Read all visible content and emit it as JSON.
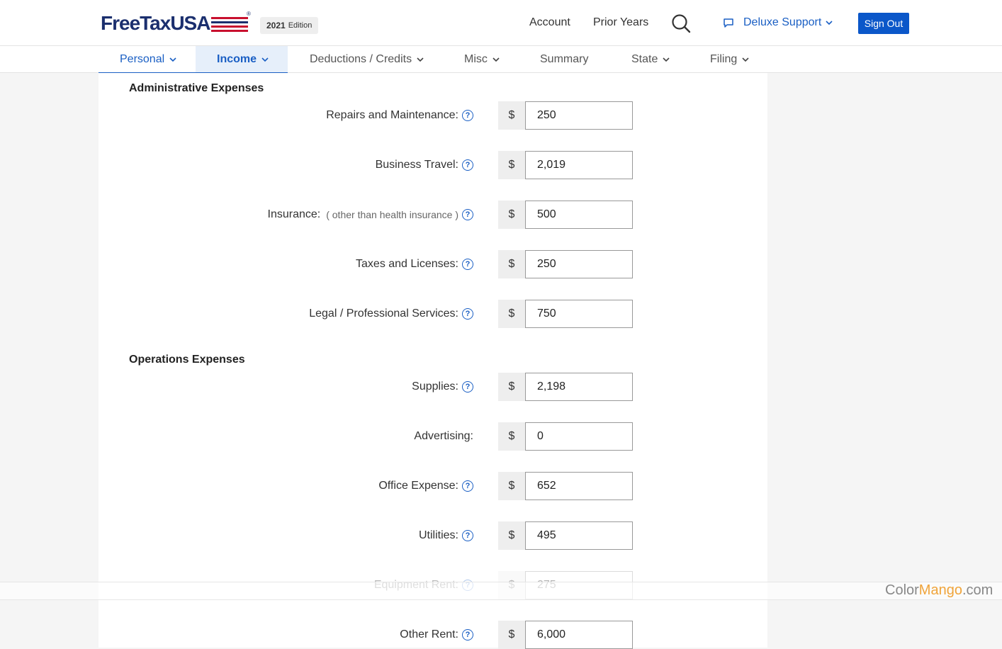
{
  "header": {
    "logo_text": "FreeTaxUSA",
    "edition_year": "2021",
    "edition_label": "Edition",
    "nav_account": "Account",
    "nav_prior_years": "Prior Years",
    "support_label": "Deluxe Support",
    "signout_label": "Sign Out"
  },
  "tabs": [
    {
      "label": "Personal"
    },
    {
      "label": "Income"
    },
    {
      "label": "Deductions / Credits"
    },
    {
      "label": "Misc"
    },
    {
      "label": "Summary"
    },
    {
      "label": "State"
    },
    {
      "label": "Filing"
    }
  ],
  "sections": {
    "admin_title": "Administrative Expenses",
    "ops_title": "Operations Expenses"
  },
  "currency": "$",
  "rows": [
    {
      "label": "Repairs and Maintenance:",
      "value": "250"
    },
    {
      "label": "Business Travel:",
      "value": "2,019"
    },
    {
      "label": "Insurance:",
      "sub": "( other than health insurance )",
      "value": "500"
    },
    {
      "label": "Taxes and Licenses:",
      "value": "250"
    },
    {
      "label": "Legal / Professional Services:",
      "value": "750"
    },
    {
      "label": "Supplies:",
      "value": "2,198"
    },
    {
      "label": "Advertising:",
      "value": "0"
    },
    {
      "label": "Office Expense:",
      "value": "652"
    },
    {
      "label": "Utilities:",
      "value": "495"
    },
    {
      "label": "Equipment Rent:",
      "value": "275"
    },
    {
      "label": "Other Rent:",
      "value": "6,000"
    }
  ],
  "help_glyph": "?",
  "watermark": {
    "part1": "Color",
    "part2": "Mango",
    "part3": ".com"
  },
  "colors": {
    "accent": "#1a5fc4",
    "brand_navy": "#1b2f6e",
    "brand_red": "#c8102e",
    "button": "#0b57c9"
  }
}
